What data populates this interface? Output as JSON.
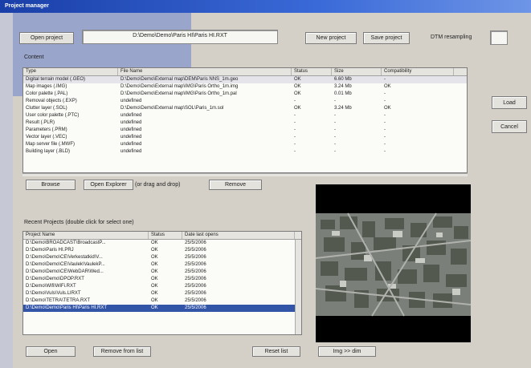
{
  "window": {
    "title": "Project manager"
  },
  "top": {
    "open_project": "Open project",
    "project_path": "D:\\Demo\\Demo\\Paris HI\\Paris HI.RXT",
    "new_project": "New project",
    "save_project": "Save project",
    "dtm_label": "DTM resampling",
    "dtm_value": ""
  },
  "content": {
    "section_label": "Content",
    "columns": [
      "Type",
      "File Name",
      "Status",
      "Size",
      "Compatibility"
    ],
    "rows": [
      [
        "Digital terrain model (.GEO)",
        "D:\\Demo\\Demo\\External map\\DEM\\Paris NNS_1m.geo",
        "OK",
        "6.60 Mb",
        "-"
      ],
      [
        "Map images (.IMG)",
        "D:\\Demo\\Demo\\External map\\IMG\\Paris Ortho_1m.img",
        "OK",
        "3.24 Mb",
        "OK"
      ],
      [
        "Color palette (.PAL)",
        "D:\\Demo\\Demo\\External map\\IMG\\Paris Ortho_1m.pal",
        "OK",
        "0.01 Mb",
        "-"
      ],
      [
        "Removal objects (.EXP)",
        "undefined",
        "-",
        "-",
        "-"
      ],
      [
        "Clutter layer (.SOL)",
        "D:\\Demo\\Demo\\External map\\SOL\\Paris_1m.sol",
        "OK",
        "3.24 Mb",
        "OK"
      ],
      [
        "User color palette (.PTC)",
        "undefined",
        "-",
        "-",
        "-"
      ],
      [
        "Result (.PLR)",
        "undefined",
        "-",
        "-",
        "-"
      ],
      [
        "Parameters (.PRM)",
        "undefined",
        "-",
        "-",
        "-"
      ],
      [
        "Vector layer (.VEC)",
        "undefined",
        "-",
        "-",
        "-"
      ],
      [
        "Map server file (.MWF)",
        "undefined",
        "-",
        "-",
        "-"
      ],
      [
        "Building layer (.BLD)",
        "undefined",
        "-",
        "-",
        "-"
      ]
    ],
    "browse": "Browse",
    "open_explorer": "Open Explorer",
    "drag_drop": "(or drag and drop)",
    "remove": "Remove"
  },
  "side": {
    "load": "Load",
    "cancel": "Cancel"
  },
  "recent": {
    "section_label": "Recent Projects (double click for select one)",
    "columns": [
      "Project Name",
      "Status",
      "Date last opens"
    ],
    "rows": [
      [
        "D:\\Demo\\BROADCAST\\BroadcastP...",
        "OK",
        "25/5/2006"
      ],
      [
        "D:\\Demo\\Paris HI.PRJ",
        "OK",
        "25/5/2006"
      ],
      [
        "D:\\Demo\\Demo\\CE\\Verkestatkid\\V...",
        "OK",
        "25/5/2006"
      ],
      [
        "D:\\Demo\\Demo\\CE\\Vaulek\\VaulekP...",
        "OK",
        "25/5/2006"
      ],
      [
        "D:\\Demo\\Demo\\CE\\WebDAR\\Wed...",
        "OK",
        "25/5/2006"
      ],
      [
        "D:\\Demo\\Demo\\DPOP.RXT",
        "OK",
        "25/5/2006"
      ],
      [
        "D:\\Demo\\Wifi\\WiFi.RXT",
        "OK",
        "25/5/2006"
      ],
      [
        "D:\\Demo\\Vuls\\Vuls.LIRXT",
        "OK",
        "25/5/2006"
      ],
      [
        "D:\\Demo\\TETRA\\TETRA.RXT",
        "OK",
        "25/5/2006"
      ],
      [
        "D:\\Demo\\Demo\\Paris HI\\Paris HI.RXT",
        "OK",
        "25/5/2006"
      ]
    ],
    "open": "Open",
    "remove_from_list": "Remove from list",
    "reset_list": "Reset list"
  },
  "preview": {
    "zoom_button": "Img >> dim"
  }
}
